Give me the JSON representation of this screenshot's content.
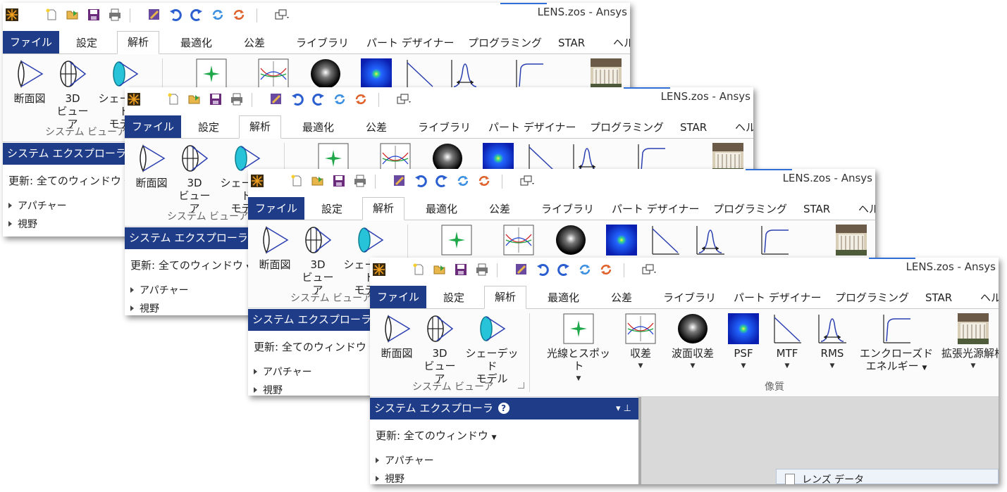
{
  "app": {
    "title": "LENS.zos - Ansys"
  },
  "tabs": {
    "file": "ファイル",
    "settings": "設定",
    "analysis": "解析",
    "optimize": "最適化",
    "tolerance": "公差",
    "library": "ライブラリ",
    "part_designer": "パート デザイナー",
    "programming": "プログラミング",
    "star": "STAR",
    "help": "ヘルプ"
  },
  "system_viewer": {
    "cross_section": "断面図",
    "view3d_line1": "3D",
    "view3d_line2": "ビューア",
    "shaded_line1": "シェーデッド",
    "shaded_line2": "モデル",
    "group_label": "システム ビューア"
  },
  "image_quality": {
    "ray_spot": "光線とスポット",
    "aberrations": "収差",
    "wavefront": "波面収差",
    "psf": "PSF",
    "mtf": "MTF",
    "rms": "RMS",
    "ee_line1": "エンクローズド",
    "ee_line2": "エネルギー",
    "extended_source": "拡張光源解析",
    "group_label": "像質"
  },
  "explorer": {
    "title": "システム エクスプローラ",
    "help_glyph": "?",
    "update": "更新: 全てのウィンドウ",
    "items": [
      "アパチャー",
      "視野"
    ],
    "pin_glyph": "▾ ⊥"
  },
  "lens_data": "レンズ データ",
  "colors": {
    "brand_blue": "#1f3c88",
    "ribbon_bg": "#fbfbfb",
    "accent": "#2f6fd6"
  }
}
